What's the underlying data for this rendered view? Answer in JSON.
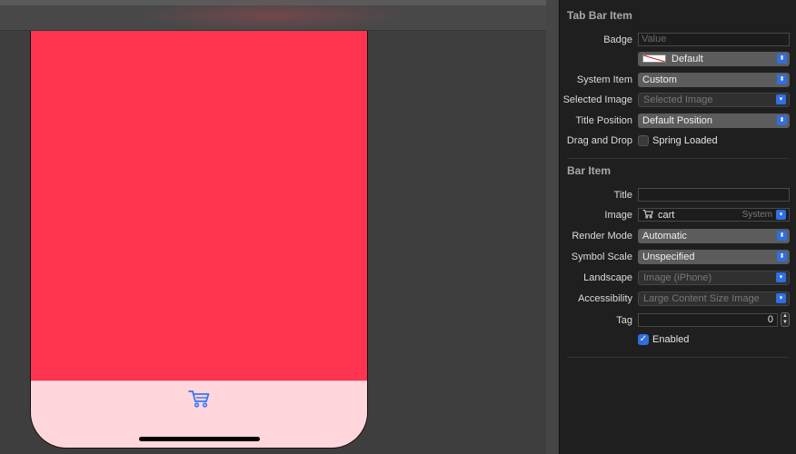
{
  "inspector": {
    "tab_bar_item": {
      "section_title": "Tab Bar Item",
      "badge_label": "Badge",
      "badge_placeholder": "Value",
      "badge_color_value": "Default",
      "system_item_label": "System Item",
      "system_item_value": "Custom",
      "selected_image_label": "Selected Image",
      "selected_image_placeholder": "Selected Image",
      "title_position_label": "Title Position",
      "title_position_value": "Default Position",
      "drag_drop_label": "Drag and Drop",
      "spring_loaded_label": "Spring Loaded",
      "spring_loaded_checked": false
    },
    "bar_item": {
      "section_title": "Bar Item",
      "title_label": "Title",
      "title_value": "",
      "image_label": "Image",
      "image_value": "cart",
      "image_source": "System",
      "render_mode_label": "Render Mode",
      "render_mode_value": "Automatic",
      "symbol_scale_label": "Symbol Scale",
      "symbol_scale_value": "Unspecified",
      "landscape_label": "Landscape",
      "landscape_placeholder": "Image (iPhone)",
      "accessibility_label": "Accessibility",
      "accessibility_placeholder": "Large Content Size Image",
      "tag_label": "Tag",
      "tag_value": "0",
      "enabled_label": "Enabled",
      "enabled_checked": true
    }
  },
  "canvas": {
    "tab_icon": "cart-icon",
    "colors": {
      "view_background": "#ff3450",
      "tab_bar_background": "#ffd6dc",
      "tab_icon_tint": "#3478f6",
      "accent": "#2f6fe0"
    }
  }
}
